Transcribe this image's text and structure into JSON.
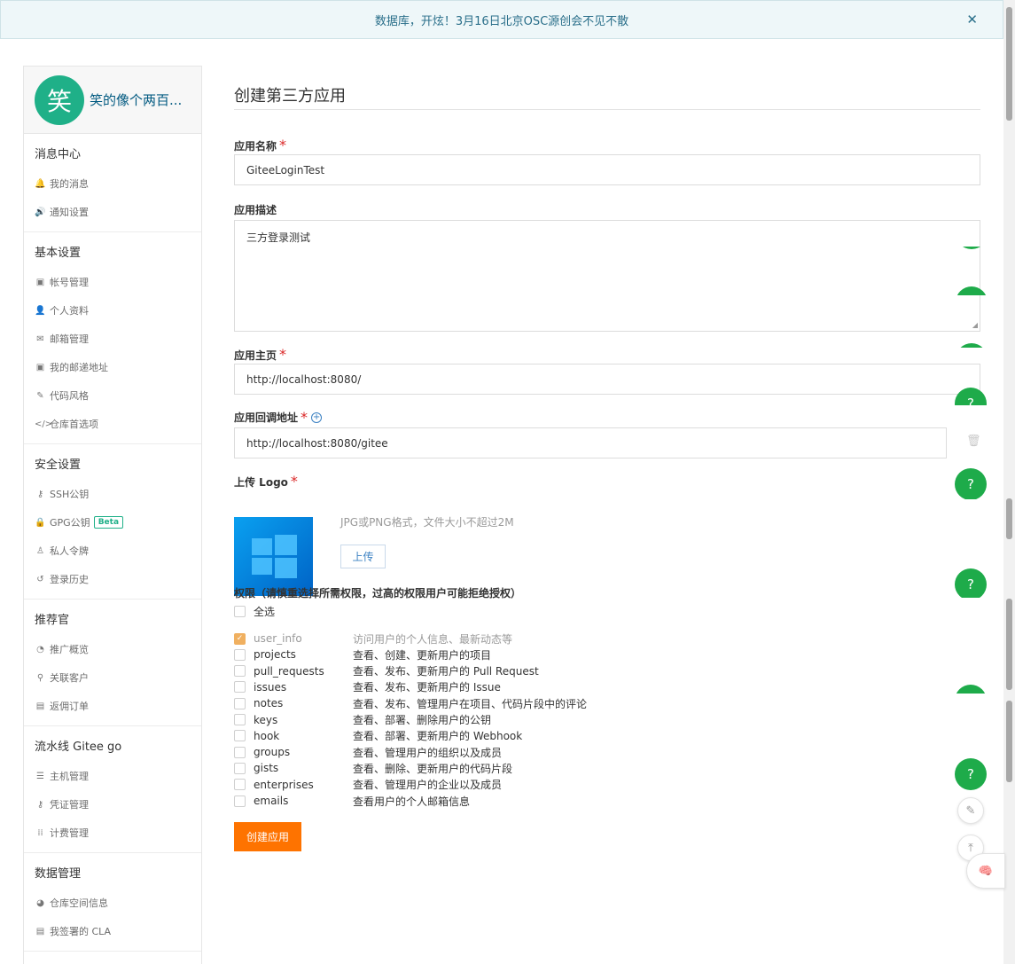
{
  "banner": {
    "text": "数据库，开炫！3月16日北京OSC源创会不见不散",
    "close": "✕"
  },
  "user": {
    "avatar_char": "笑",
    "name": "笑的像个两百..."
  },
  "sidebar": {
    "sections": [
      {
        "title": "消息中心",
        "items": [
          {
            "icon": "bell-icon",
            "glyph": "🔔",
            "label": "我的消息"
          },
          {
            "icon": "volume-icon",
            "glyph": "🔊",
            "label": "通知设置"
          }
        ]
      },
      {
        "title": "基本设置",
        "items": [
          {
            "icon": "id-card-icon",
            "glyph": "▣",
            "label": "帐号管理"
          },
          {
            "icon": "user-icon",
            "glyph": "👤",
            "label": "个人资料"
          },
          {
            "icon": "mail-icon",
            "glyph": "✉",
            "label": "邮箱管理"
          },
          {
            "icon": "id-card-icon",
            "glyph": "▣",
            "label": "我的邮递地址"
          },
          {
            "icon": "brush-icon",
            "glyph": "✎",
            "label": "代码风格"
          },
          {
            "icon": "code-icon",
            "glyph": "</>",
            "label": "仓库首选项"
          }
        ]
      },
      {
        "title": "安全设置",
        "items": [
          {
            "icon": "key-icon",
            "glyph": "⚷",
            "label": "SSH公钥"
          },
          {
            "icon": "lock-icon",
            "glyph": "🔒",
            "label": "GPG公钥",
            "badge": "Beta"
          },
          {
            "icon": "token-icon",
            "glyph": "♙",
            "label": "私人令牌"
          },
          {
            "icon": "history-icon",
            "glyph": "↺",
            "label": "登录历史"
          }
        ]
      },
      {
        "title": "推荐官",
        "items": [
          {
            "icon": "chart-icon",
            "glyph": "◔",
            "label": "推广概览"
          },
          {
            "icon": "user-link-icon",
            "glyph": "⚲",
            "label": "关联客户"
          },
          {
            "icon": "order-icon",
            "glyph": "▤",
            "label": "返佣订单"
          }
        ]
      },
      {
        "title": "流水线 Gitee go",
        "items": [
          {
            "icon": "server-icon",
            "glyph": "☰",
            "label": "主机管理"
          },
          {
            "icon": "key-icon",
            "glyph": "⚷",
            "label": "凭证管理"
          },
          {
            "icon": "billing-icon",
            "glyph": "⁞⁞",
            "label": "计费管理"
          }
        ]
      },
      {
        "title": "数据管理",
        "items": [
          {
            "icon": "pie-icon",
            "glyph": "◕",
            "label": "仓库空间信息"
          },
          {
            "icon": "file-icon",
            "glyph": "▤",
            "label": "我签署的 CLA"
          }
        ]
      }
    ]
  },
  "form": {
    "title": "创建第三方应用",
    "name_label": "应用名称",
    "name_value": "GiteeLoginTest",
    "desc_label": "应用描述",
    "desc_value": "三方登录测试",
    "home_label": "应用主页",
    "home_value": "http://localhost:8080/",
    "callback_label": "应用回调地址",
    "callback_value": "http://localhost:8080/gitee",
    "logo_label": "上传 Logo",
    "logo_hint": "JPG或PNG格式，文件大小不超过2M",
    "upload_label": "上传",
    "required_mark": "*",
    "perm_title": "权限（请慎重选择所需权限，过高的权限用户可能拒绝授权）",
    "select_all": "全选",
    "permissions": [
      {
        "name": "user_info",
        "desc": "访问用户的个人信息、最新动态等",
        "checked": true,
        "disabled": true
      },
      {
        "name": "projects",
        "desc": "查看、创建、更新用户的项目",
        "checked": false
      },
      {
        "name": "pull_requests",
        "desc": "查看、发布、更新用户的 Pull Request",
        "checked": false
      },
      {
        "name": "issues",
        "desc": "查看、发布、更新用户的 Issue",
        "checked": false
      },
      {
        "name": "notes",
        "desc": "查看、发布、管理用户在项目、代码片段中的评论",
        "checked": false
      },
      {
        "name": "keys",
        "desc": "查看、部署、删除用户的公钥",
        "checked": false
      },
      {
        "name": "hook",
        "desc": "查看、部署、更新用户的 Webhook",
        "checked": false
      },
      {
        "name": "groups",
        "desc": "查看、管理用户的组织以及成员",
        "checked": false
      },
      {
        "name": "gists",
        "desc": "查看、删除、更新用户的代码片段",
        "checked": false
      },
      {
        "name": "enterprises",
        "desc": "查看、管理用户的企业以及成员",
        "checked": false
      },
      {
        "name": "emails",
        "desc": "查看用户的个人邮箱信息",
        "checked": false
      }
    ],
    "submit_label": "创建应用"
  },
  "floating": {
    "help": "?",
    "feedback": "✎",
    "top": "⤒",
    "brain": "🧠"
  },
  "colors": {
    "accent_green": "#1eab4a",
    "brand_orange": "#fe7300",
    "link_blue": "#005980"
  }
}
